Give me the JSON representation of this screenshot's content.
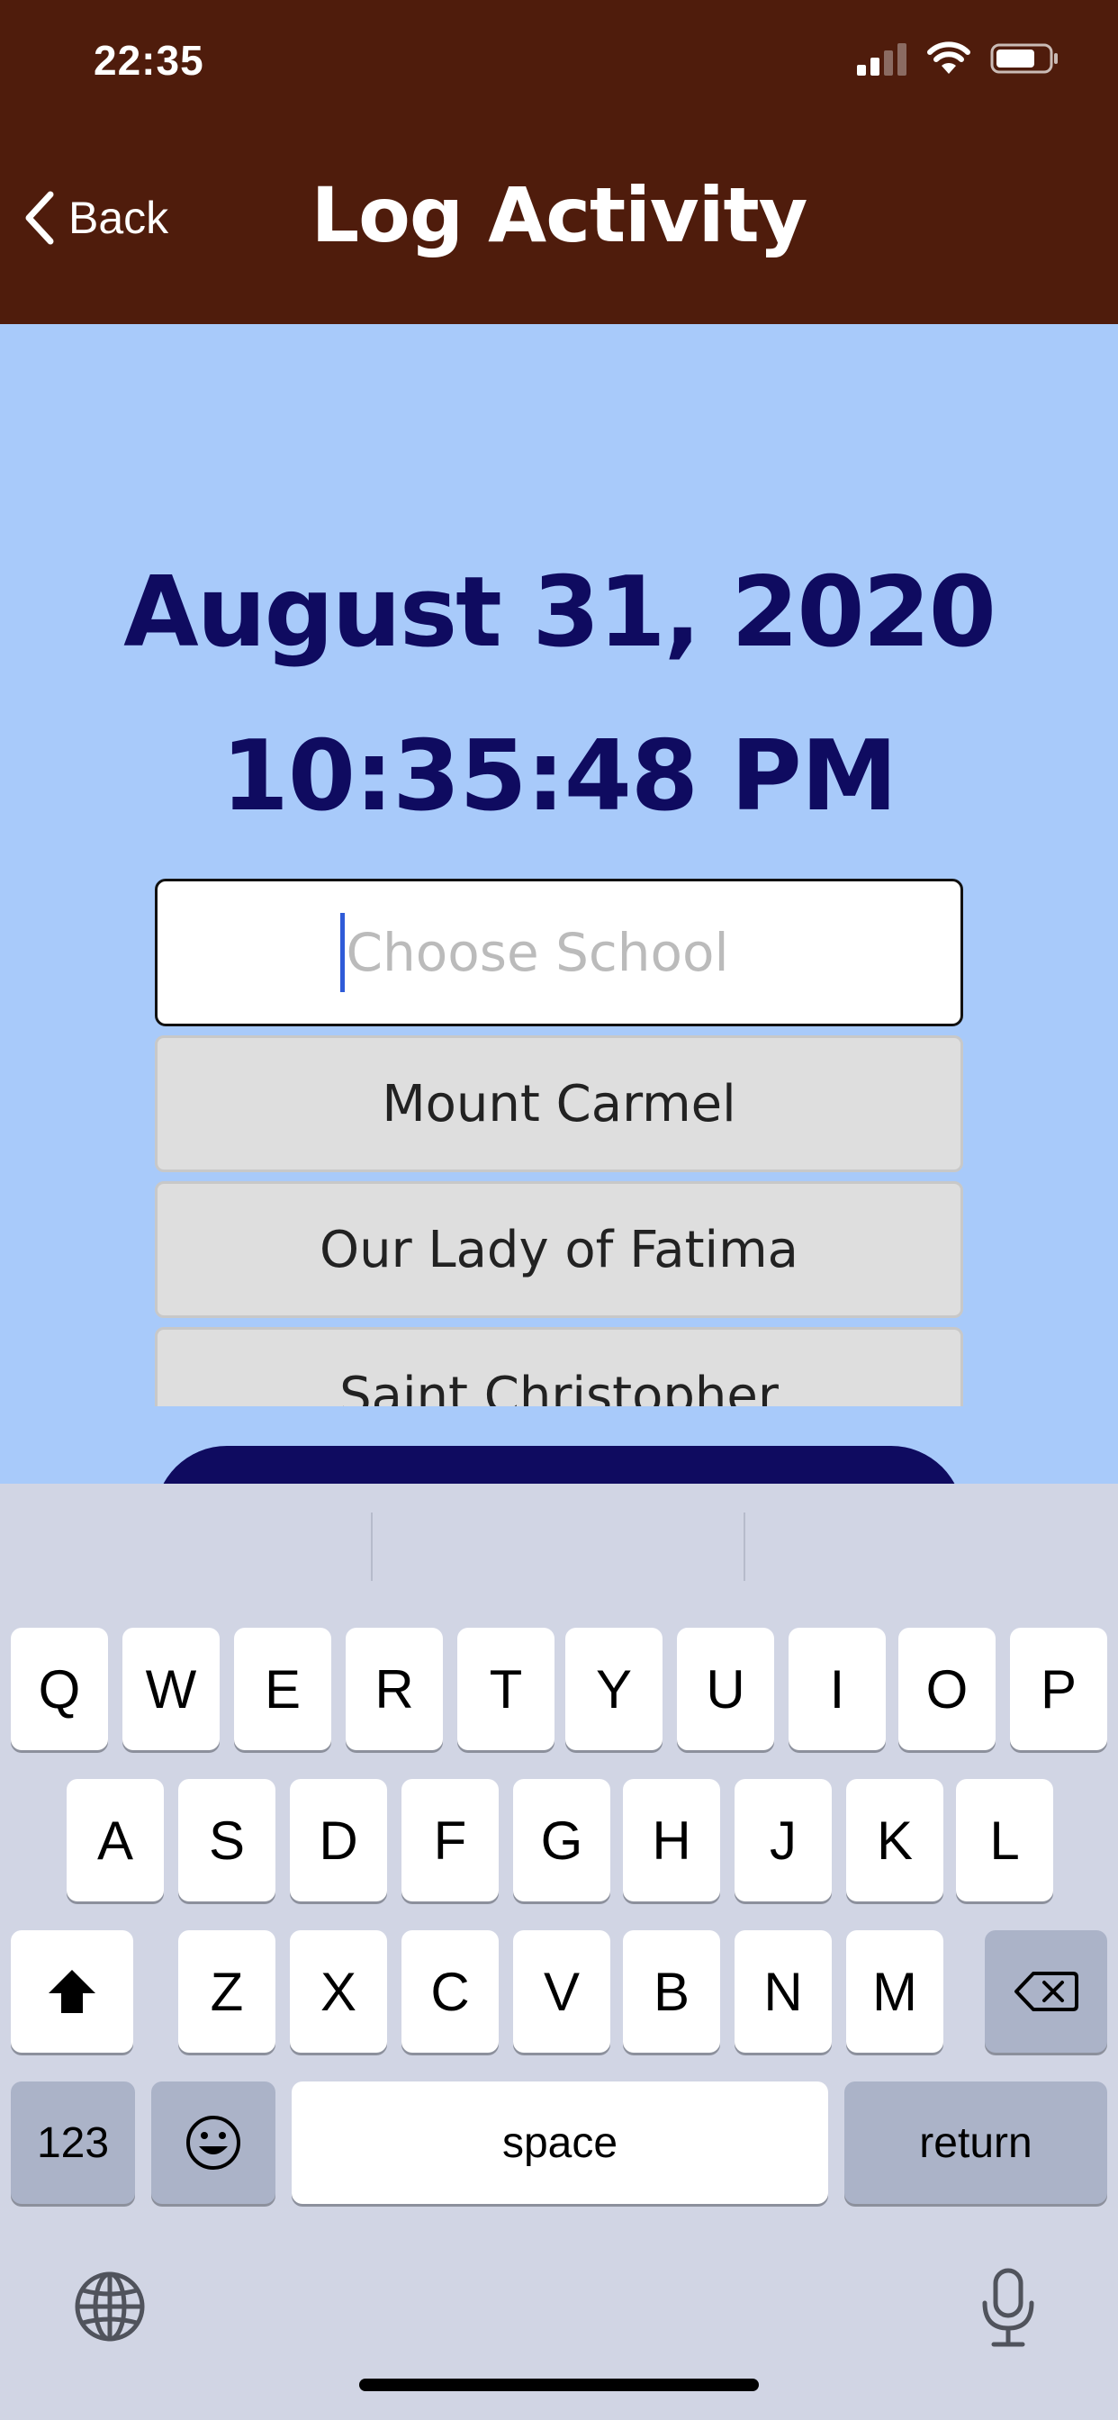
{
  "status_bar": {
    "time": "22:35"
  },
  "nav": {
    "back_label": "Back",
    "title": "Log Activity"
  },
  "main": {
    "date": "August 31, 2020",
    "time": "10:35:48 PM",
    "school_input": {
      "value": "",
      "placeholder": "Choose School"
    },
    "school_options": [
      "Mount Carmel",
      "Our Lady of Fatima",
      "Saint Christopher"
    ]
  },
  "keyboard": {
    "row1": [
      "Q",
      "W",
      "E",
      "R",
      "T",
      "Y",
      "U",
      "I",
      "O",
      "P"
    ],
    "row2": [
      "A",
      "S",
      "D",
      "F",
      "G",
      "H",
      "J",
      "K",
      "L"
    ],
    "row3": [
      "Z",
      "X",
      "C",
      "V",
      "B",
      "N",
      "M"
    ],
    "numbers_label": "123",
    "space_label": "space",
    "return_label": "return"
  },
  "colors": {
    "header_bg": "#4f1c0c",
    "page_bg": "#a8cafa",
    "accent_text": "#0f0b60",
    "keyboard_bg": "#d1d5e4"
  },
  "icons": [
    "back-chevron-icon",
    "signal-icon",
    "wifi-icon",
    "battery-icon",
    "shift-icon",
    "backspace-icon",
    "emoji-icon",
    "globe-icon",
    "microphone-icon"
  ]
}
